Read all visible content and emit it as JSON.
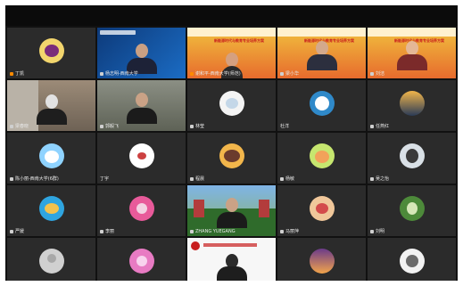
{
  "window": {
    "title": ""
  },
  "participants": [
    {
      "label": "丁凯",
      "mic_active": true,
      "kind": "avatar",
      "avatar_colors": [
        "#f2d56d",
        "#7a2c7a"
      ]
    },
    {
      "label": "杨志明-西南大学",
      "mic_active": false,
      "kind": "video-blue"
    },
    {
      "label": "谢和平-西南大学(师范)",
      "mic_active": true,
      "kind": "banner",
      "banner_text": "新能源时代与教育专业培养方案"
    },
    {
      "label": "梁小华",
      "mic_active": false,
      "kind": "banner",
      "banner_text": "新能源时代与教育专业培养方案"
    },
    {
      "label": "刘洁",
      "mic_active": false,
      "kind": "banner",
      "banner_text": "新能源时代与教育专业培养方案"
    },
    {
      "label": "梁春晓",
      "mic_active": false,
      "kind": "video-room"
    },
    {
      "label": "郭毅飞",
      "mic_active": false,
      "kind": "video-man"
    },
    {
      "label": "林莹",
      "mic_active": false,
      "kind": "avatar",
      "avatar_colors": [
        "#f4f4f4",
        "#c4d7e8"
      ]
    },
    {
      "label": "杜洋",
      "mic_active": false,
      "kind": "avatar",
      "avatar_colors": [
        "#2f89c9",
        "#ffffff"
      ]
    },
    {
      "label": "任燕红",
      "mic_active": false,
      "kind": "avatar",
      "avatar_colors": [
        "#f1b54a",
        "#2a3b57"
      ]
    },
    {
      "label": "陈小丽-西南大学(6群)",
      "mic_active": false,
      "kind": "avatar",
      "avatar_colors": [
        "#8fd3ff",
        "#ffffff"
      ]
    },
    {
      "label": "丁宇",
      "mic_active": false,
      "kind": "avatar",
      "avatar_colors": [
        "#ffffff",
        "#cc4040"
      ]
    },
    {
      "label": "程晨",
      "mic_active": false,
      "kind": "avatar",
      "avatar_colors": [
        "#f2b64b",
        "#6b3b2d"
      ]
    },
    {
      "label": "杨敏",
      "mic_active": false,
      "kind": "avatar",
      "avatar_colors": [
        "#c6e66f",
        "#f2a25a"
      ]
    },
    {
      "label": "吴之怡",
      "mic_active": false,
      "kind": "avatar",
      "avatar_colors": [
        "#d9e0e6",
        "#3a3a3a"
      ]
    },
    {
      "label": "严媛",
      "mic_active": false,
      "kind": "avatar",
      "avatar_colors": [
        "#2fa5e0",
        "#f3c24d"
      ]
    },
    {
      "label": "李丽",
      "mic_active": false,
      "kind": "avatar",
      "avatar_colors": [
        "#e85a9a",
        "#f3d2e3"
      ]
    },
    {
      "label": "ZHANG YUEGANG",
      "mic_active": false,
      "kind": "video-outdoor"
    },
    {
      "label": "马丽萍",
      "mic_active": false,
      "kind": "avatar",
      "avatar_colors": [
        "#f0c79a",
        "#d34b4b"
      ]
    },
    {
      "label": "刘明",
      "mic_active": false,
      "kind": "avatar",
      "avatar_colors": [
        "#4d8a3a",
        "#d6e7b8"
      ]
    },
    {
      "label": "",
      "mic_active": false,
      "kind": "avatar",
      "avatar_colors": [
        "#d0d0d0",
        "#a8a8a8"
      ]
    },
    {
      "label": "",
      "mic_active": false,
      "kind": "avatar",
      "avatar_colors": [
        "#e87bc3",
        "#f8d3ee"
      ]
    },
    {
      "label": "",
      "mic_active": false,
      "kind": "video-white"
    },
    {
      "label": "",
      "mic_active": false,
      "kind": "avatar",
      "avatar_colors": [
        "#6a3a8a",
        "#f2a44b"
      ]
    },
    {
      "label": "",
      "mic_active": false,
      "kind": "avatar",
      "avatar_colors": [
        "#f2f2f2",
        "#6a6a6a"
      ]
    }
  ]
}
